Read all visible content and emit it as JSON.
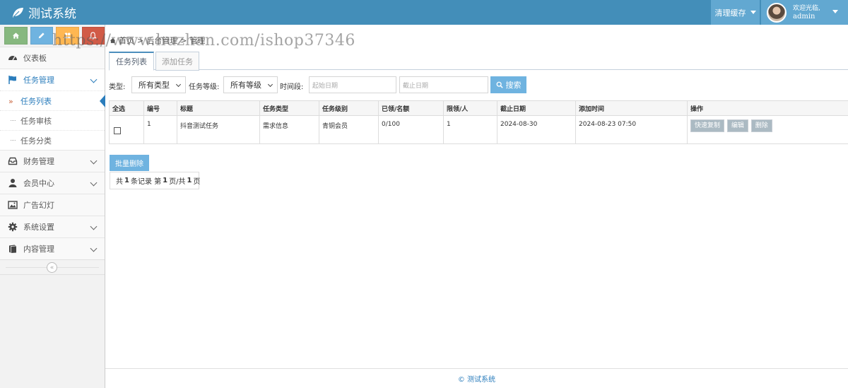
{
  "app": {
    "title": "测试系统",
    "footer": "© 测试系统"
  },
  "navbar": {
    "clear_cache": "清理缓存",
    "welcome": "欢迎光临,",
    "username": "admin"
  },
  "shortcuts": [
    {
      "icon": "home-icon",
      "color": "#87b87f"
    },
    {
      "icon": "pencil-icon",
      "color": "#6fb3e0"
    },
    {
      "icon": "users-icon",
      "color": "#ffb752"
    },
    {
      "icon": "bell-icon",
      "color": "#d15b47"
    }
  ],
  "sidebar": {
    "items": [
      {
        "label": "仪表板",
        "icon": "dashboard-icon"
      },
      {
        "label": "任务管理",
        "icon": "flag-icon"
      },
      {
        "label": "财务管理",
        "icon": "inbox-icon"
      },
      {
        "label": "会员中心",
        "icon": "user-icon"
      },
      {
        "label": "广告幻灯",
        "icon": "picture-icon"
      },
      {
        "label": "系统设置",
        "icon": "gear-icon"
      },
      {
        "label": "内容管理",
        "icon": "book-icon"
      }
    ],
    "sub_items": [
      {
        "label": "任务列表"
      },
      {
        "label": "任务审核"
      },
      {
        "label": "任务分类"
      }
    ],
    "collapse_glyph": "«"
  },
  "breadcrumb": {
    "home": "首页",
    "sep1": ">",
    "section": "后台管理",
    "sep2": ">",
    "page": "管理"
  },
  "watermark": "https://www.huzhan.com/ishop37346",
  "tabs": [
    {
      "label": "任务列表"
    },
    {
      "label": "添加任务"
    }
  ],
  "filter": {
    "type_label": "类型:",
    "type_value": "所有类型",
    "level_label": "任务等级:",
    "level_value": "所有等级",
    "period_label": "时间段:",
    "start_placeholder": "起始日期",
    "end_placeholder": "截止日期",
    "search_label": "搜索"
  },
  "table": {
    "headers": [
      "全选",
      "编号",
      "标题",
      "任务类型",
      "任务级别",
      "已领/名额",
      "限领/人",
      "截止日期",
      "添加时间",
      "操作"
    ],
    "rows": [
      {
        "id": "1",
        "title": "抖音测试任务",
        "type": "需求信息",
        "level": "青铜会员",
        "claimed": "0/100",
        "limit": "1",
        "deadline": "2024-08-30",
        "added": "2024-08-23 07:50",
        "actions": [
          "快速复制",
          "编辑",
          "删除"
        ]
      }
    ]
  },
  "batch_delete": "批量删除",
  "pager": {
    "prefix": "共",
    "records": "1",
    "records_suffix": "条记录 第",
    "page": "1",
    "page_suffix": "页/共",
    "total": "1",
    "total_suffix": "页"
  }
}
